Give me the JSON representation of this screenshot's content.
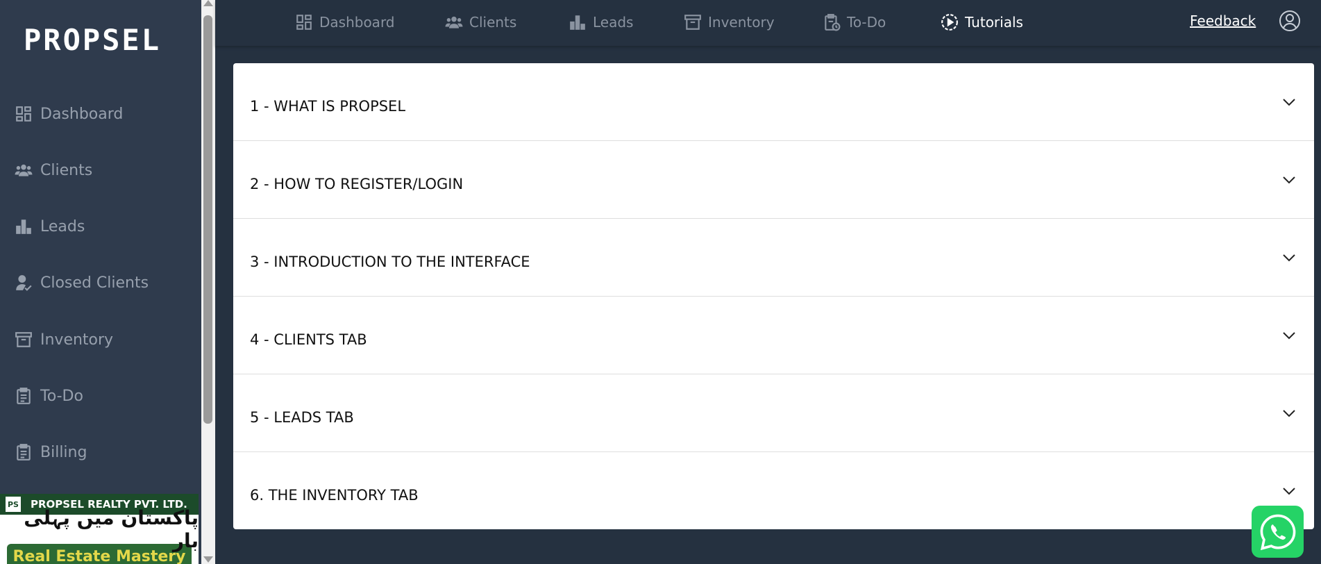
{
  "app": {
    "logo_text": "PROPSEL"
  },
  "sidebar": {
    "items": [
      {
        "label": "Dashboard",
        "icon": "dashboard-icon"
      },
      {
        "label": "Clients",
        "icon": "users-icon"
      },
      {
        "label": "Leads",
        "icon": "bar-chart-icon"
      },
      {
        "label": "Closed Clients",
        "icon": "user-check-icon"
      },
      {
        "label": "Inventory",
        "icon": "archive-icon"
      },
      {
        "label": "To-Do",
        "icon": "clipboard-icon"
      },
      {
        "label": "Billing",
        "icon": "clipboard-icon"
      }
    ]
  },
  "banner": {
    "company": "PROPSEL REALTY PVT. LTD.",
    "urdu_text": "پاکستان میں پہلی بار",
    "bottom_text": "Real Estate Mastery"
  },
  "topnav": {
    "items": [
      {
        "label": "Dashboard",
        "icon": "dashboard-icon",
        "active": false
      },
      {
        "label": "Clients",
        "icon": "users-icon",
        "active": false
      },
      {
        "label": "Leads",
        "icon": "bar-chart-icon",
        "active": false
      },
      {
        "label": "Inventory",
        "icon": "archive-icon",
        "active": false
      },
      {
        "label": "To-Do",
        "icon": "clipboard-clock-icon",
        "active": false
      },
      {
        "label": "Tutorials",
        "icon": "play-circle-icon",
        "active": true
      }
    ],
    "feedback_label": "Feedback"
  },
  "tutorials": {
    "items": [
      {
        "title": "1 - WHAT IS PROPSEL"
      },
      {
        "title": "2 - HOW TO REGISTER/LOGIN"
      },
      {
        "title": "3 - INTRODUCTION TO THE INTERFACE"
      },
      {
        "title": "4 - CLIENTS TAB"
      },
      {
        "title": "5 - LEADS TAB"
      },
      {
        "title": "6. THE INVENTORY TAB"
      }
    ]
  },
  "colors": {
    "page_bg": "#253140",
    "sidebar_bg": "#2f3b4d",
    "muted_text": "#97a0ad",
    "whatsapp_green": "#25d366"
  }
}
